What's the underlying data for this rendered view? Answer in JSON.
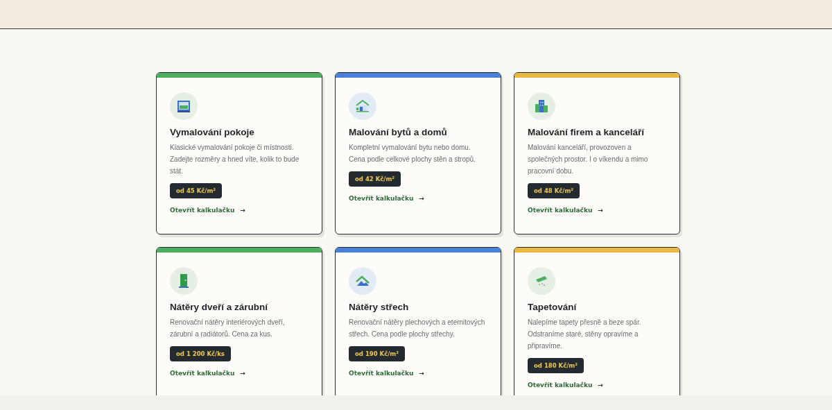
{
  "cards": [
    {
      "kind": "room",
      "color": "#4caf60",
      "title": "Vymalování pokoje",
      "text": "Klasické vymalování pokoje či místnosti. Zadejte rozměry a hned víte, kolik to bude stát.",
      "price": "od 45 Kč/m²",
      "link": "Otevřít kalkulačku",
      "arrow": "→"
    },
    {
      "kind": "house",
      "color": "#4a80d8",
      "title": "Malování bytů a domů",
      "text": "Kompletní vymalování bytu nebo domu. Cena podle celkové plochy stěn a stropů.",
      "price": "od 42 Kč/m²",
      "link": "Otevřít kalkulačku",
      "arrow": "→"
    },
    {
      "kind": "office",
      "color": "#e8b840",
      "title": "Malování firem a kanceláří",
      "text": "Malování kanceláří, provozoven a společných prostor. I o víkendu a mimo pracovní dobu.",
      "price": "od 48 Kč/m²",
      "link": "Otevřít kalkulačku",
      "arrow": "→"
    },
    {
      "kind": "door",
      "color": "#4caf60",
      "title": "Nátěry dveří a zárubní",
      "text": "Renovační nátěry interiérových dveří, zárubní a radiátorů. Cena za kus.",
      "price": "od 1 200 Kč/ks",
      "link": "Otevřít kalkulačku",
      "arrow": "→"
    },
    {
      "kind": "roof",
      "color": "#4a80d8",
      "title": "Nátěry střech",
      "text": "Renovační nátěry plechových a eternitových střech. Cena podle plochy střechy.",
      "price": "od 190 Kč/m²",
      "link": "Otevřít kalkulačku",
      "arrow": "→"
    },
    {
      "kind": "wallpaper",
      "color": "#e8b840",
      "title": "Tapetování",
      "text": "Nalepíme tapety přesně a beze spár. Odstraníme staré, stěny opravíme a připravíme.",
      "price": "od 180 Kč/m²",
      "link": "Otevřít kalkulačku",
      "arrow": "→"
    }
  ]
}
